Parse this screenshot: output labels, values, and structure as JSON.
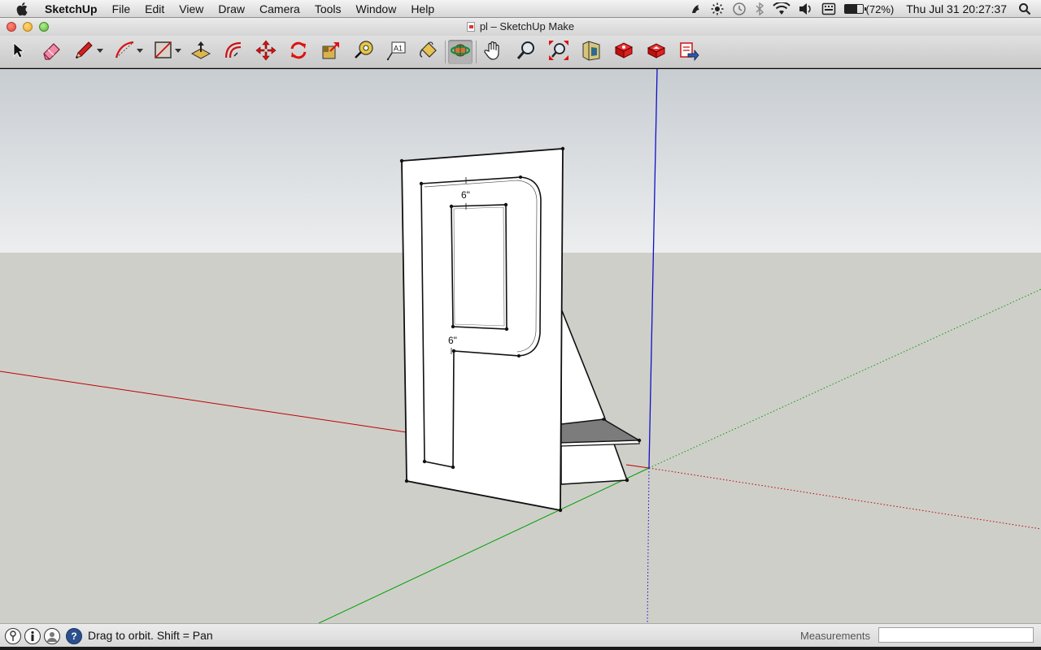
{
  "menubar": {
    "app_name": "SketchUp",
    "items": [
      "File",
      "Edit",
      "View",
      "Draw",
      "Camera",
      "Tools",
      "Window",
      "Help"
    ],
    "battery_percent": "(72%)",
    "datetime": "Thu Jul 31  20:27:37"
  },
  "window": {
    "title": "pl – SketchUp Make"
  },
  "toolbar": {
    "tools": [
      {
        "name": "select",
        "icon": "arrow-cursor-icon",
        "active": false
      },
      {
        "name": "eraser",
        "icon": "eraser-icon",
        "active": false
      },
      {
        "name": "line",
        "icon": "pencil-icon",
        "active": false,
        "dropdown": true
      },
      {
        "name": "arc",
        "icon": "arc-icon",
        "active": false,
        "dropdown": true
      },
      {
        "name": "rectangle",
        "icon": "rectangle-icon",
        "active": false,
        "dropdown": true
      },
      {
        "name": "push-pull",
        "icon": "push-pull-icon",
        "active": false
      },
      {
        "name": "offset",
        "icon": "offset-icon",
        "active": false
      },
      {
        "name": "move",
        "icon": "move-icon",
        "active": false
      },
      {
        "name": "rotate",
        "icon": "rotate-icon",
        "active": false
      },
      {
        "name": "scale",
        "icon": "scale-icon",
        "active": false
      },
      {
        "name": "tape-measure",
        "icon": "tape-measure-icon",
        "active": false
      },
      {
        "name": "text",
        "icon": "text-icon",
        "active": false
      },
      {
        "name": "paint-bucket",
        "icon": "paint-bucket-icon",
        "active": false
      },
      {
        "name": "orbit",
        "icon": "orbit-icon",
        "active": true
      },
      {
        "name": "pan",
        "icon": "hand-icon",
        "active": false
      },
      {
        "name": "zoom",
        "icon": "magnifier-icon",
        "active": false
      },
      {
        "name": "zoom-extents",
        "icon": "zoom-extents-icon",
        "active": false
      },
      {
        "name": "3d-warehouse",
        "icon": "warehouse-icon",
        "active": false
      },
      {
        "name": "extension-warehouse",
        "icon": "extension-icon",
        "active": false
      },
      {
        "name": "share-model",
        "icon": "share-model-icon",
        "active": false
      },
      {
        "name": "share-component",
        "icon": "share-component-icon",
        "active": false
      }
    ]
  },
  "model": {
    "dimension_top": "6\"",
    "dimension_left": "6\"",
    "colors": {
      "sky": "#c9ced3",
      "ground": "#cfcfc9",
      "red_axis": "#c00000",
      "green_axis": "#00a000",
      "blue_axis": "#1010c8"
    }
  },
  "statusbar": {
    "help_text": "Drag to orbit.  Shift = Pan",
    "measurements_label": "Measurements",
    "measurements_value": ""
  }
}
